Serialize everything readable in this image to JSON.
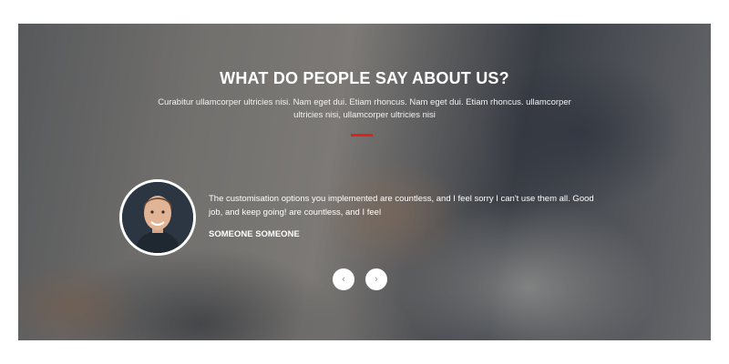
{
  "testimonials": {
    "heading": "WHAT DO PEOPLE SAY ABOUT US?",
    "subheading": "Curabitur ullamcorper ultricies nisi. Nam eget dui. Etiam rhoncus. Nam eget dui. Etiam rhoncus. ullamcorper ultricies nisi, ullamcorper ultricies nisi",
    "accent_color": "#e01f1f",
    "quote": "The customisation options you implemented are countless, and I feel sorry I can't use them all. Good job, and keep going! are countless, and I feel",
    "author": "SOMEONE SOMEONE",
    "prev_icon": "chevron-left-icon",
    "next_icon": "chevron-right-icon",
    "prev_glyph": "‹",
    "next_glyph": "›"
  }
}
